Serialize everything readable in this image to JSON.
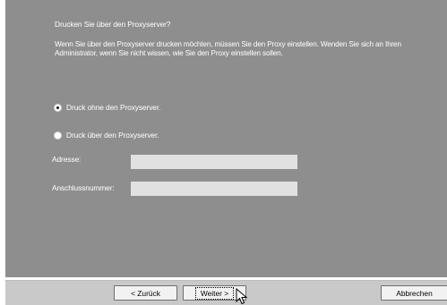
{
  "dialog": {
    "heading": "Drucken Sie über den Proxyserver?",
    "description": "Wenn Sie über den Proxyserver drucken möchten, müssen Sie den Proxy einstellen. Wenden Sie sich an Ihren Administrator, wenn Sie nicht wissen, wie Sie den Proxy einstellen sollen."
  },
  "options": [
    {
      "label": "Druck ohne den Proxyserver.",
      "selected": true
    },
    {
      "label": "Druck über den Proxyserver.",
      "selected": false
    }
  ],
  "fields": {
    "address": {
      "label": "Adresse:",
      "value": ""
    },
    "port": {
      "label": "Anschlussnummer:",
      "value": ""
    }
  },
  "buttons": {
    "back": "< Zurück",
    "next": "Weiter >",
    "cancel": "Abbrechen"
  },
  "icons": {
    "cursor": "pointer-cursor-icon"
  },
  "colors": {
    "panel_bg": "#8e8e8e",
    "footer_bg": "#c9c9c9",
    "field_bg": "#e1e1e1"
  }
}
